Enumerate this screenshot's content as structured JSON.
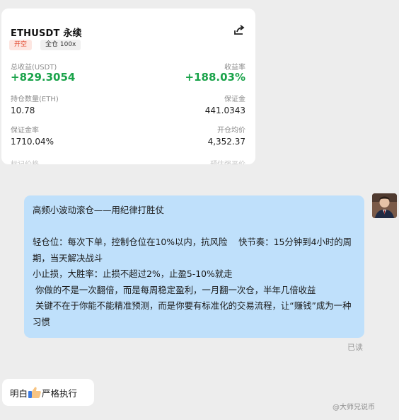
{
  "position_card": {
    "symbol": "ETHUSDT 永续",
    "chevron": "›",
    "tag_open": "开空",
    "tag_margin": "全仓 100x",
    "total_pnl_label": "总收益(USDT)",
    "total_pnl_value": "+829.3054",
    "roi_label": "收益率",
    "roi_value": "+188.03%",
    "qty_label": "持仓数量(ETH)",
    "qty_value": "10.78",
    "margin_label": "保证金",
    "margin_value": "441.0343",
    "margin_rate_label": "保证金率",
    "margin_rate_value": "1710.04%",
    "entry_label": "开仓均价",
    "entry_value": "4,352.37",
    "mark_label_partial": "标记价格",
    "liq_label_partial": "预估强平价"
  },
  "message_sent": {
    "text": "高频小波动滚仓——用纪律打胜仗\n\n轻仓位：每次下单，控制仓位在10%以内，抗风险    快节奏：15分钟到4小时的周期，当天解决战斗\n小止损，大胜率：止损不超过2%，止盈5-10%就走\n 你做的不是一次翻倍，而是每周稳定盈利，一月翻一次仓，半年几倍收益\n 关键不在于你能不能精准预测，而是你要有标准化的交易流程，让“赚钱”成为一种习惯",
    "read_status": "已读"
  },
  "message_received": {
    "text_before": "明白",
    "text_after": "严格执行"
  },
  "watermark": "@大师兄说币",
  "icons": [
    "share-icon",
    "thumbs-up-icon",
    "avatar"
  ],
  "colors": {
    "profit_green": "#1aa34a",
    "short_red": "#e24a2f",
    "bubble_blue": "#bfe0fb"
  }
}
